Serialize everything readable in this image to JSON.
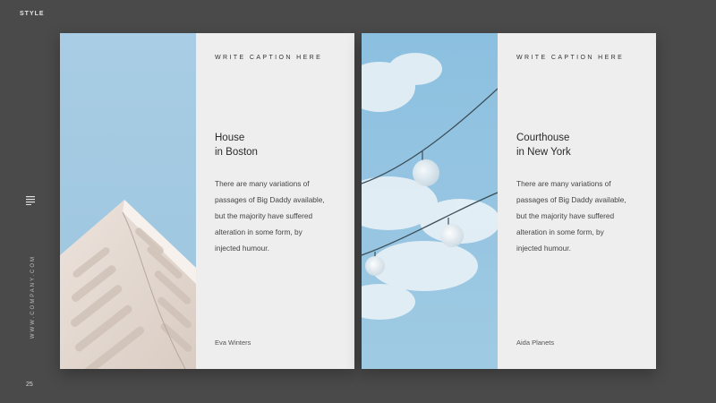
{
  "header": {
    "brand": "STYLE"
  },
  "sidebar": {
    "url": "WWW.COMPANY.COM",
    "menu_icon": "menu-lines-icon"
  },
  "footer": {
    "page_number": "25"
  },
  "cards": [
    {
      "caption": "WRITE CAPTION HERE",
      "title_lines": [
        "House",
        "in Boston"
      ],
      "body_lines": [
        "There are many variations of",
        "passages of Big Daddy available,",
        "but the majority have suffered",
        "alteration in some form, by",
        "injected humour."
      ],
      "author": "Eva Winters"
    },
    {
      "caption": "WRITE CAPTION HERE",
      "title_lines": [
        "Courthouse",
        "in New York"
      ],
      "body_lines": [
        "There are many variations of",
        "passages of Big Daddy available,",
        "but the majority have suffered",
        "alteration in some form, by",
        "injected humour."
      ],
      "author": "Aida Planets"
    }
  ],
  "colors": {
    "background": "#4a4a4a",
    "card": "#eeeeee",
    "sky": "#9fc6df"
  }
}
